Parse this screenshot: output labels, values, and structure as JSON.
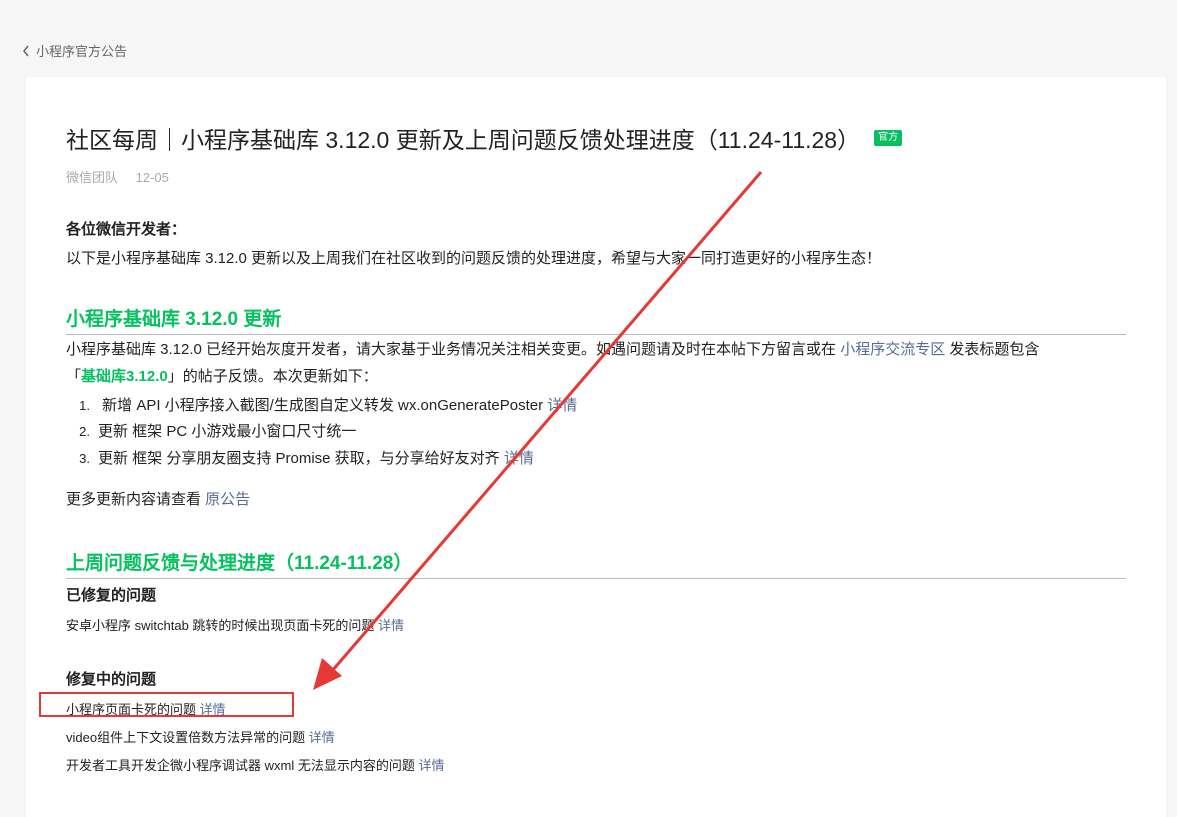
{
  "nav": {
    "back_label": "小程序官方公告"
  },
  "article": {
    "title": "社区每周｜小程序基础库 3.12.0 更新及上周问题反馈处理进度（11.24-11.28）",
    "badge": "官方",
    "author": "微信团队",
    "date": "12-05",
    "greeting": "各位微信开发者：",
    "intro": "以下是小程序基础库 3.12.0 更新以及上周我们在社区收到的问题反馈的处理进度，希望与大家一同打造更好的小程序生态！"
  },
  "section1": {
    "heading": "小程序基础库 3.12.0 更新",
    "para_part1": "小程序基础库 3.12.0 已经开始灰度开发者，请大家基于业务情况关注相关变更。如遇问题请及时在本帖下方留言或在 ",
    "para_link": "小程序交流专区",
    "para_part2": " 发表标题包含",
    "para2_open": "「",
    "para2_tag": "基础库3.12.0",
    "para2_rest": "」的帖子反馈。本次更新如下：",
    "items": [
      {
        "num": "1.",
        "text": " 新增 API 小程序接入截图/生成图自定义转发 wx.onGeneratePoster ",
        "link": "详情"
      },
      {
        "num": "2.",
        "text": "更新 框架 PC 小游戏最小窗口尺寸统一",
        "link": ""
      },
      {
        "num": "3.",
        "text": "更新 框架 分享朋友圈支持 Promise 获取，与分享给好友对齐 ",
        "link": "详情"
      }
    ],
    "more_text": "更多更新内容请查看 ",
    "more_link": "原公告"
  },
  "section2": {
    "heading": "上周问题反馈与处理进度（11.24-11.28）",
    "fixed_heading": "已修复的问题",
    "fixed_items": [
      {
        "text": "安卓小程序 switchtab 跳转的时候出现页面卡死的问题 ",
        "link": "详情"
      }
    ],
    "fixing_heading": "修复中的问题",
    "fixing_items": [
      {
        "text": "小程序页面卡死的问题 ",
        "link": "详情"
      },
      {
        "text": "video组件上下文设置倍数方法异常的问题 ",
        "link": "详情"
      },
      {
        "text": "开发者工具开发企微小程序调试器 wxml 无法显示内容的问题 ",
        "link": "详情"
      }
    ]
  },
  "colors": {
    "accent_green": "#07c160",
    "link_blue": "#576b95",
    "annotation_red": "#e53935"
  }
}
